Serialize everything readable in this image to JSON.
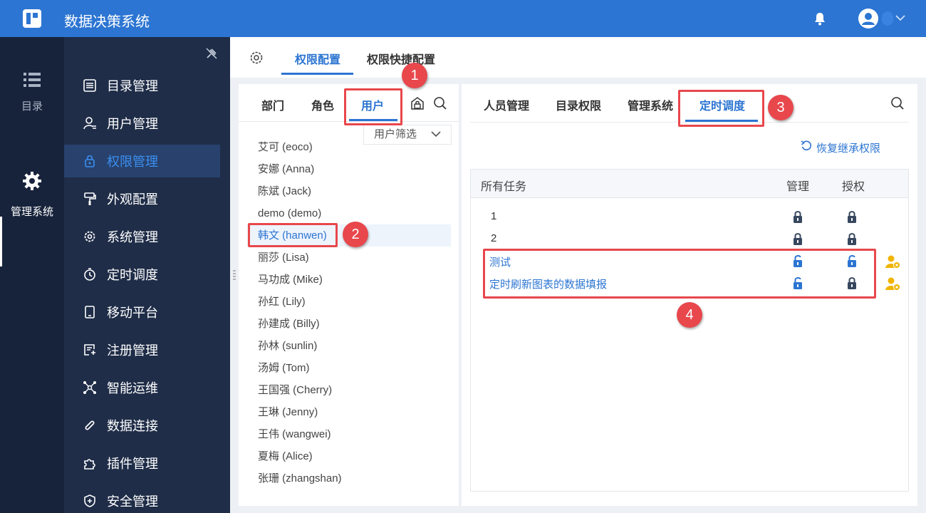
{
  "app": {
    "title": "数据决策系统"
  },
  "nav_primary": [
    {
      "label": "目录",
      "icon": "list-icon"
    },
    {
      "label": "管理系统",
      "icon": "gear-icon"
    }
  ],
  "nav_secondary": [
    {
      "label": "目录管理",
      "icon": "catalog-icon"
    },
    {
      "label": "用户管理",
      "icon": "user-icon"
    },
    {
      "label": "权限管理",
      "icon": "lock-icon"
    },
    {
      "label": "外观配置",
      "icon": "paint-roller-icon"
    },
    {
      "label": "系统管理",
      "icon": "settings-icon"
    },
    {
      "label": "定时调度",
      "icon": "timer-icon"
    },
    {
      "label": "移动平台",
      "icon": "tablet-icon"
    },
    {
      "label": "注册管理",
      "icon": "register-icon"
    },
    {
      "label": "智能运维",
      "icon": "network-icon"
    },
    {
      "label": "数据连接",
      "icon": "link-icon"
    },
    {
      "label": "插件管理",
      "icon": "puzzle-icon"
    },
    {
      "label": "安全管理",
      "icon": "shield-icon"
    }
  ],
  "top_tabs": [
    "权限配置",
    "权限快捷配置"
  ],
  "left_tabs": [
    "部门",
    "角色",
    "用户"
  ],
  "user_filter": "用户筛选",
  "users": [
    "艾可 (eoco)",
    "安娜 (Anna)",
    "陈斌 (Jack)",
    "demo (demo)",
    "韩文 (hanwen)",
    "丽莎 (Lisa)",
    "马功成 (Mike)",
    "孙红 (Lily)",
    "孙建成 (Billy)",
    "孙林 (sunlin)",
    "汤姆 (Tom)",
    "王国强 (Cherry)",
    "王琳 (Jenny)",
    "王伟 (wangwei)",
    "夏梅 (Alice)",
    "张珊 (zhangshan)"
  ],
  "right_tabs": [
    "人员管理",
    "目录权限",
    "管理系统",
    "定时调度"
  ],
  "restore_label": "恢复继承权限",
  "table": {
    "headers": {
      "task": "所有任务",
      "manage": "管理",
      "authorize": "授权"
    },
    "rows": [
      {
        "name": "1",
        "manage": "locked",
        "authorize": "locked"
      },
      {
        "name": "2",
        "manage": "locked",
        "authorize": "locked"
      },
      {
        "name": "测试",
        "manage": "unlocked",
        "authorize": "unlocked"
      },
      {
        "name": "定时刷新图表的数据填报",
        "manage": "unlocked",
        "authorize": "locked"
      }
    ]
  },
  "callouts": [
    "1",
    "2",
    "3",
    "4"
  ],
  "colors": {
    "accent": "#2c75d2",
    "callout": "#e8474c",
    "nav_dark": "#1f2d48"
  }
}
